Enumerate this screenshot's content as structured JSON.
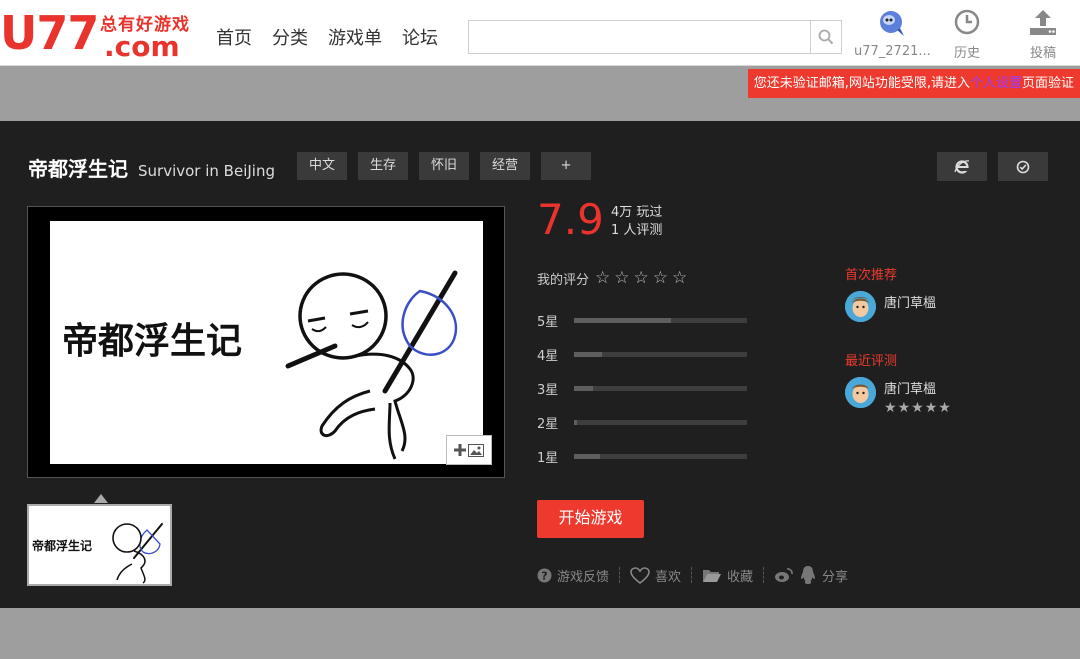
{
  "header": {
    "logo_text": "U77",
    "logo_slogan": "总有好游戏",
    "logo_domain": ".com",
    "nav": [
      "首页",
      "分类",
      "游戏单",
      "论坛"
    ],
    "search_placeholder": "",
    "username": "u77_2721...",
    "history_label": "历史",
    "upload_label": "投稿"
  },
  "notice": {
    "text_before": "您还未验证邮箱,网站功能受限,请进入",
    "link_text": "个人设置",
    "text_after": "页面验证"
  },
  "game": {
    "title_cn": "帝都浮生记",
    "title_en": "Survivor in BeiJing",
    "tags": [
      "中文",
      "生存",
      "怀旧",
      "经营"
    ],
    "add_tag_label": "+",
    "preview_text": "帝都浮生记",
    "thumb_text": "帝都浮生记"
  },
  "rating": {
    "score": "7.9",
    "plays": "4万 玩过",
    "reviews": "1 人评测",
    "my_rating_label": "我的评分",
    "distribution": [
      {
        "label": "5星",
        "fraction": 0.56
      },
      {
        "label": "4星",
        "fraction": 0.16
      },
      {
        "label": "3星",
        "fraction": 0.11
      },
      {
        "label": "2星",
        "fraction": 0.02
      },
      {
        "label": "1星",
        "fraction": 0.15
      }
    ]
  },
  "actions": {
    "play_label": "开始游戏",
    "feedback_label": "游戏反馈",
    "like_label": "喜欢",
    "collect_label": "收藏",
    "share_label": "分享"
  },
  "side": {
    "first_rec_label": "首次推荐",
    "first_rec_user": "唐门草榲",
    "recent_label": "最近评测",
    "recent_user": "唐门草榲",
    "recent_stars": 5
  },
  "colors": {
    "brand": "#e8342c",
    "dark_bg": "#1f1f1f",
    "page_bg": "#9e9e9e",
    "link": "#9a3cff"
  }
}
